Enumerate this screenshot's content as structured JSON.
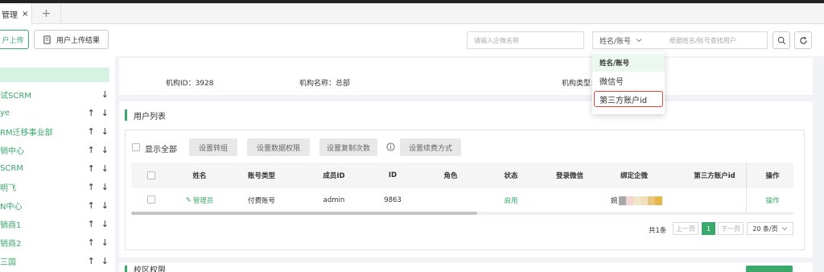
{
  "tabs": {
    "active_label": "管理",
    "close": "×",
    "add": "+"
  },
  "toolbar": {
    "upload_label": "户上传",
    "upload_result_label": "用户上传结果",
    "org_search_placeholder": "请输入企微名称",
    "search_type_value": "姓名/账号",
    "user_search_placeholder": "根据姓名/账号查找用户"
  },
  "dropdown": {
    "options": [
      {
        "label": "姓名/账号"
      },
      {
        "label": "微信号"
      },
      {
        "label": "第三方账户id"
      }
    ]
  },
  "sidebar": {
    "items": [
      {
        "label": ""
      },
      {
        "label": "试SCRM"
      },
      {
        "label": "ye"
      },
      {
        "label": "RM迁移事业部"
      },
      {
        "label": "销中心"
      },
      {
        "label": "SCRM"
      },
      {
        "label": "明飞"
      },
      {
        "label": "N中心"
      },
      {
        "label": "销商1"
      },
      {
        "label": "销商2"
      },
      {
        "label": "三国"
      }
    ]
  },
  "org_info": {
    "id_text": "机构ID：3928",
    "name_text": "机构名称：总部",
    "type_text": "机构类型："
  },
  "user_list": {
    "title": "用户列表",
    "show_all": "显示全部",
    "btn_transfer": "设置转组",
    "btn_data_perm": "设置数据权限",
    "btn_copy_count": "设置复制次数",
    "btn_renew": "设置续费方式",
    "columns": [
      "姓名",
      "账号类型",
      "成员ID",
      "ID",
      "角色",
      "状态",
      "登录微信",
      "绑定企微",
      "第三方账户id",
      "操作"
    ],
    "rows": [
      {
        "name": "管理员",
        "account_type": "付费账号",
        "member_id": "admin",
        "id": "9863",
        "role": "",
        "status": "启用",
        "login_wechat": "",
        "bound_wecom": "婉",
        "third_party_id": "",
        "action": "操作"
      }
    ]
  },
  "pagination": {
    "total": "共1条",
    "prev": "上一页",
    "current": "1",
    "next": "下一页",
    "page_size": "20 条/页"
  },
  "next_section": {
    "title": "校区权限"
  },
  "colors": {
    "accent": "#3aa86b",
    "highlight_border": "#e0463a"
  }
}
